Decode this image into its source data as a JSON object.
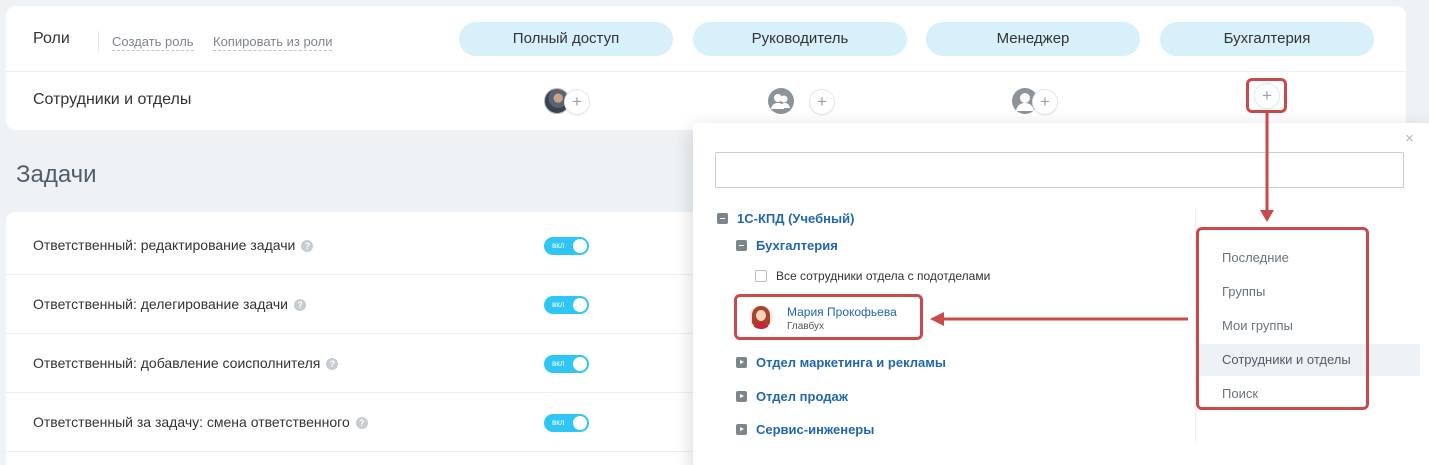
{
  "roles": {
    "title": "Роли",
    "create_link": "Создать роль",
    "copy_link": "Копировать из роли",
    "columns": [
      "Полный доступ",
      "Руководитель",
      "Менеджер",
      "Бухгалтерия"
    ]
  },
  "members": {
    "label": "Сотрудники и отделы",
    "plus": "+",
    "group_icon": "●"
  },
  "tasks": {
    "heading": "Задачи",
    "toggle_text": "вкл",
    "help": "?",
    "rows": [
      "Ответственный: редактирование задачи",
      "Ответственный: делегирование задачи",
      "Ответственный: добавление соисполнителя",
      "Ответственный за задачу: смена ответственного"
    ]
  },
  "popup": {
    "close": "×",
    "search_value": "",
    "tree": {
      "root": "1С-КПД (Учебный)",
      "department": "Бухгалтерия",
      "all_employees_checkbox": "Все сотрудники отдела с подотделами",
      "employee": {
        "name": "Мария Прокофьева",
        "title": "Главбух"
      },
      "other_departments": [
        "Отдел маркетинга и рекламы",
        "Отдел продаж",
        "Сервис-инженеры"
      ]
    },
    "nav": [
      "Последние",
      "Группы",
      "Мои группы",
      "Сотрудники и отделы",
      "Поиск"
    ],
    "active_nav": "Сотрудники и отделы"
  },
  "colors": {
    "accent_pill": "#d7f0f9",
    "toggle_on": "#2fc6f6",
    "highlight": "#c84a4a",
    "link": "#2067b0"
  }
}
